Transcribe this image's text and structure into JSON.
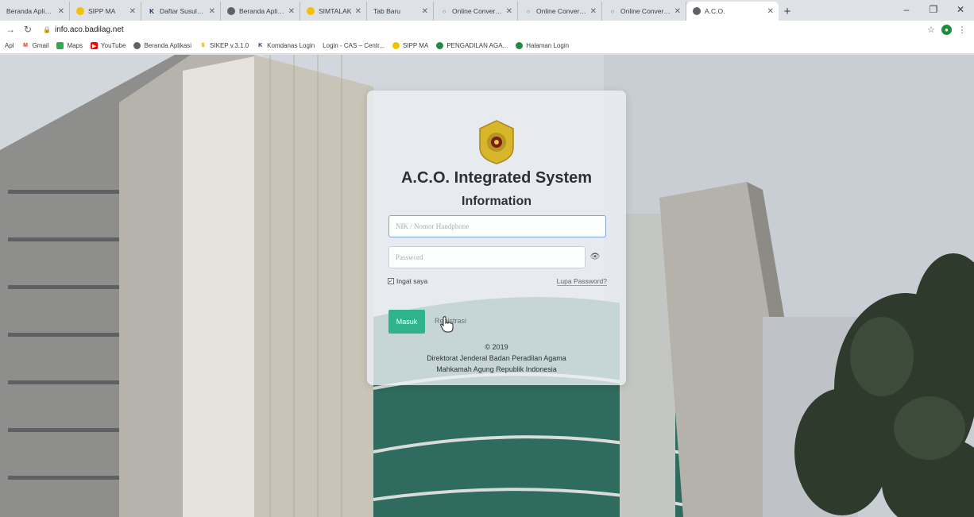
{
  "browser": {
    "tabs": [
      {
        "label": "Beranda Aplikasi",
        "icon": "none",
        "active": false
      },
      {
        "label": "SIPP MA",
        "icon": "sipp",
        "active": false
      },
      {
        "label": "Daftar Susulan/Keı",
        "icon": "k",
        "active": false
      },
      {
        "label": "Beranda Aplikasi",
        "icon": "globe",
        "active": false
      },
      {
        "label": "SIMTALAK",
        "icon": "sipp",
        "active": false
      },
      {
        "label": "Tab Baru",
        "icon": "none",
        "active": false
      },
      {
        "label": "Online Converter -",
        "icon": "converter",
        "active": false
      },
      {
        "label": "Online Converter -",
        "icon": "converter",
        "active": false
      },
      {
        "label": "Online Converter -",
        "icon": "converter",
        "active": false
      },
      {
        "label": "A.C.O.",
        "icon": "globe",
        "active": true
      }
    ],
    "url": "info.aco.badilag.net",
    "bookmarks": [
      {
        "label": "Apl",
        "icon": "none"
      },
      {
        "label": "Gmail",
        "icon": "gmail"
      },
      {
        "label": "Maps",
        "icon": "maps"
      },
      {
        "label": "YouTube",
        "icon": "youtube"
      },
      {
        "label": "Beranda Aplikasi",
        "icon": "globe"
      },
      {
        "label": "SIKEP v.3.1.0",
        "icon": "sikep"
      },
      {
        "label": "Komdanas Login",
        "icon": "k"
      },
      {
        "label": "Login - CAS – Centr...",
        "icon": "none"
      },
      {
        "label": "SIPP MA",
        "icon": "sipp"
      },
      {
        "label": "PENGADILAN AGA...",
        "icon": "green"
      },
      {
        "label": "Halaman Login",
        "icon": "green"
      }
    ]
  },
  "login": {
    "title": "A.C.O. Integrated System",
    "subtitle": "Information",
    "nik_placeholder": "NIK / Nomor Handphone",
    "password_placeholder": "Password",
    "remember_label": "Ingat saya",
    "remember_checked": true,
    "forgot_label": "Lupa Password?",
    "login_button": "Masuk",
    "register_link": "Registrasi",
    "footer": {
      "copyright": "© 2019",
      "line1": "Direktorat Jenderal Badan Peradilan Agama",
      "line2": "Mahkamah Agung Republik Indonesia"
    }
  },
  "colors": {
    "login_button": "#2fb38f",
    "card_background": "#ecf0f4",
    "input_focus_border": "#7ea6d6"
  }
}
